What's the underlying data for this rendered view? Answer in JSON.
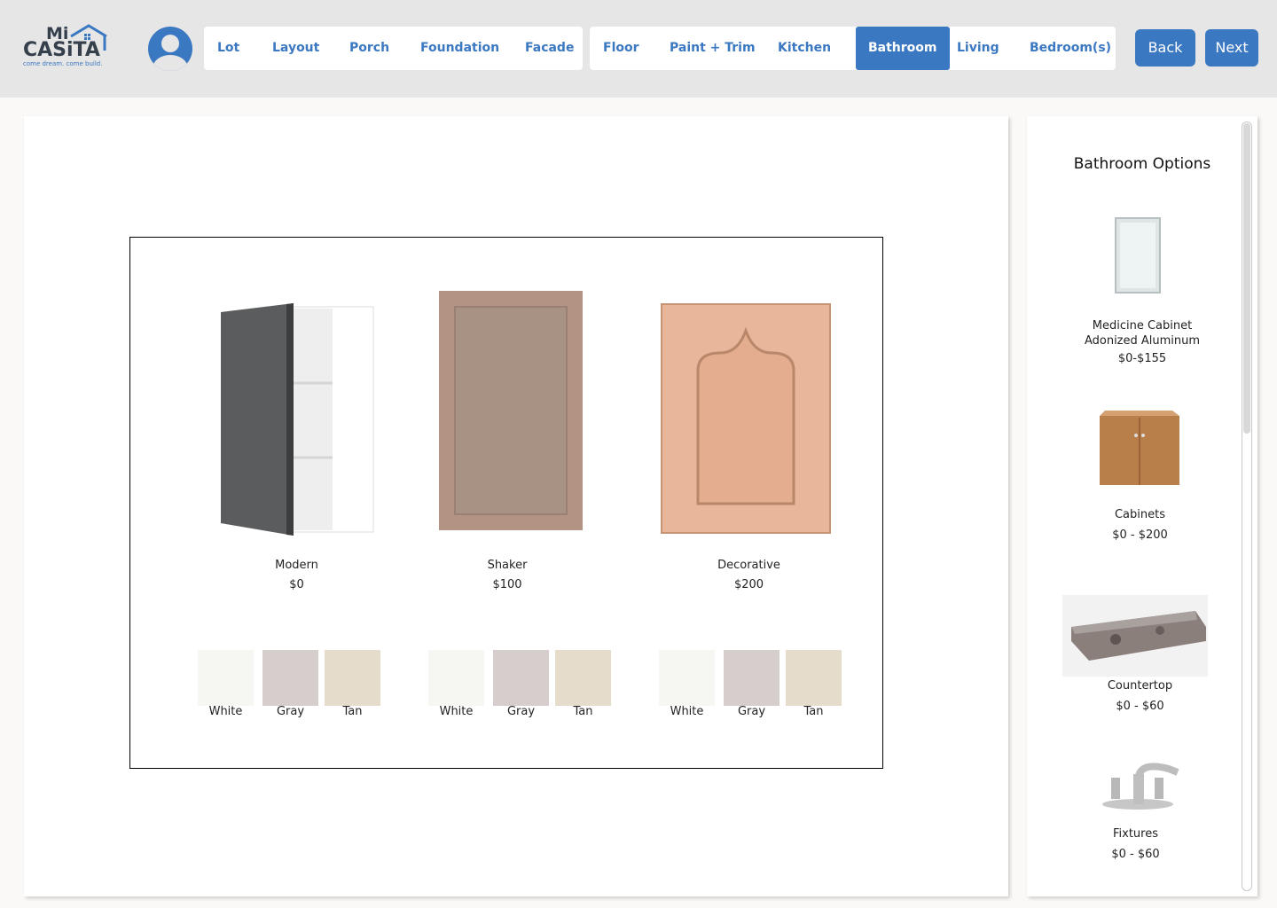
{
  "brand": {
    "line1": "Mi",
    "line2": "CASiTA",
    "tagline": "come dream. come build."
  },
  "nav": {
    "group1": [
      "Lot",
      "Layout",
      "Porch",
      "Foundation",
      "Facade"
    ],
    "group2": [
      "Floor",
      "Paint + Trim",
      "Kitchen",
      "Bathroom",
      "Living",
      "Bedroom(s)"
    ],
    "active": "Bathroom"
  },
  "actions": {
    "back": "Back",
    "next": "Next"
  },
  "colors": {
    "accent": "#3b78c2",
    "white_swatch": "#f6f7f3",
    "gray_swatch": "#d6cecc",
    "tan_swatch": "#e6dccc"
  },
  "cabinet_styles": [
    {
      "name": "Modern",
      "price": "$0",
      "icon": "modern-cabinet-image"
    },
    {
      "name": "Shaker",
      "price": "$100",
      "icon": "shaker-door-image"
    },
    {
      "name": "Decorative",
      "price": "$200",
      "icon": "decorative-door-image"
    }
  ],
  "swatches": [
    "White",
    "Gray",
    "Tan"
  ],
  "sidebar": {
    "title": "Bathroom Options",
    "items": [
      {
        "line1": "Medicine Cabinet",
        "line2": "Adonized Aluminum",
        "price": "$0-$155"
      },
      {
        "line1": "Cabinets",
        "price": "$0 - $200"
      },
      {
        "line1": "Countertop",
        "price": "$0 - $60"
      },
      {
        "line1": "Fixtures",
        "price": "$0 - $60"
      }
    ]
  }
}
